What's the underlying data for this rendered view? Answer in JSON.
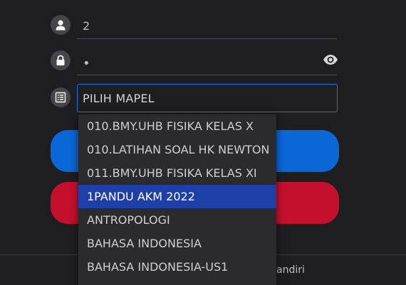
{
  "form": {
    "username": {
      "value": "2",
      "icon": "user-icon"
    },
    "password": {
      "value": "•",
      "icon": "lock-icon",
      "toggle_icon": "eye-icon"
    },
    "subject": {
      "label": "PILIH MAPEL",
      "icon": "list-icon"
    }
  },
  "dropdown": {
    "options": [
      "010.BMY.UHB FISIKA KELAS X",
      "010.LATIHAN SOAL HK NEWTON",
      "011.BMY.UHB FISIKA KELAS XI",
      "1PANDU AKM 2022",
      "ANTROPOLOGI",
      "BAHASA INDONESIA",
      "BAHASA INDONESIA-US1"
    ],
    "selected": "1PANDU AKM 2022"
  },
  "buttons": {
    "primary_color": "#0b66d6",
    "secondary_color": "#c5102d"
  },
  "footer": {
    "right_text": "andiri"
  },
  "colors": {
    "background": "#1e1e20",
    "accent": "#2a6fe0",
    "selected_option": "#1e3ea8"
  }
}
